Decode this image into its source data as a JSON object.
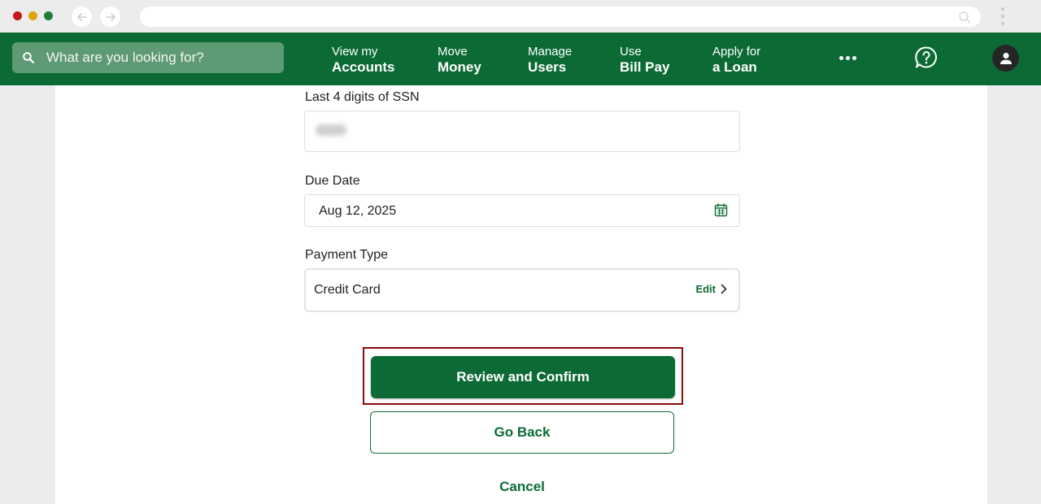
{
  "browser": {
    "url": ""
  },
  "nav": {
    "search_placeholder": "What are you looking for?",
    "items": [
      {
        "line1": "View my",
        "line2": "Accounts"
      },
      {
        "line1": "Move",
        "line2": "Money"
      },
      {
        "line1": "Manage",
        "line2": "Users"
      },
      {
        "line1": "Use",
        "line2": "Bill Pay"
      },
      {
        "line1": "Apply for",
        "line2": "a Loan"
      }
    ]
  },
  "form": {
    "ssn_label": "Last 4 digits of SSN",
    "due_date_label": "Due Date",
    "due_date_value": "Aug 12, 2025",
    "payment_type_label": "Payment Type",
    "payment_type_value": "Credit Card",
    "edit_label": "Edit"
  },
  "actions": {
    "review_label": "Review and Confirm",
    "go_back_label": "Go Back",
    "cancel_label": "Cancel"
  },
  "colors": {
    "brand_green": "#0c6b35",
    "highlight": "#8b0b0b"
  }
}
